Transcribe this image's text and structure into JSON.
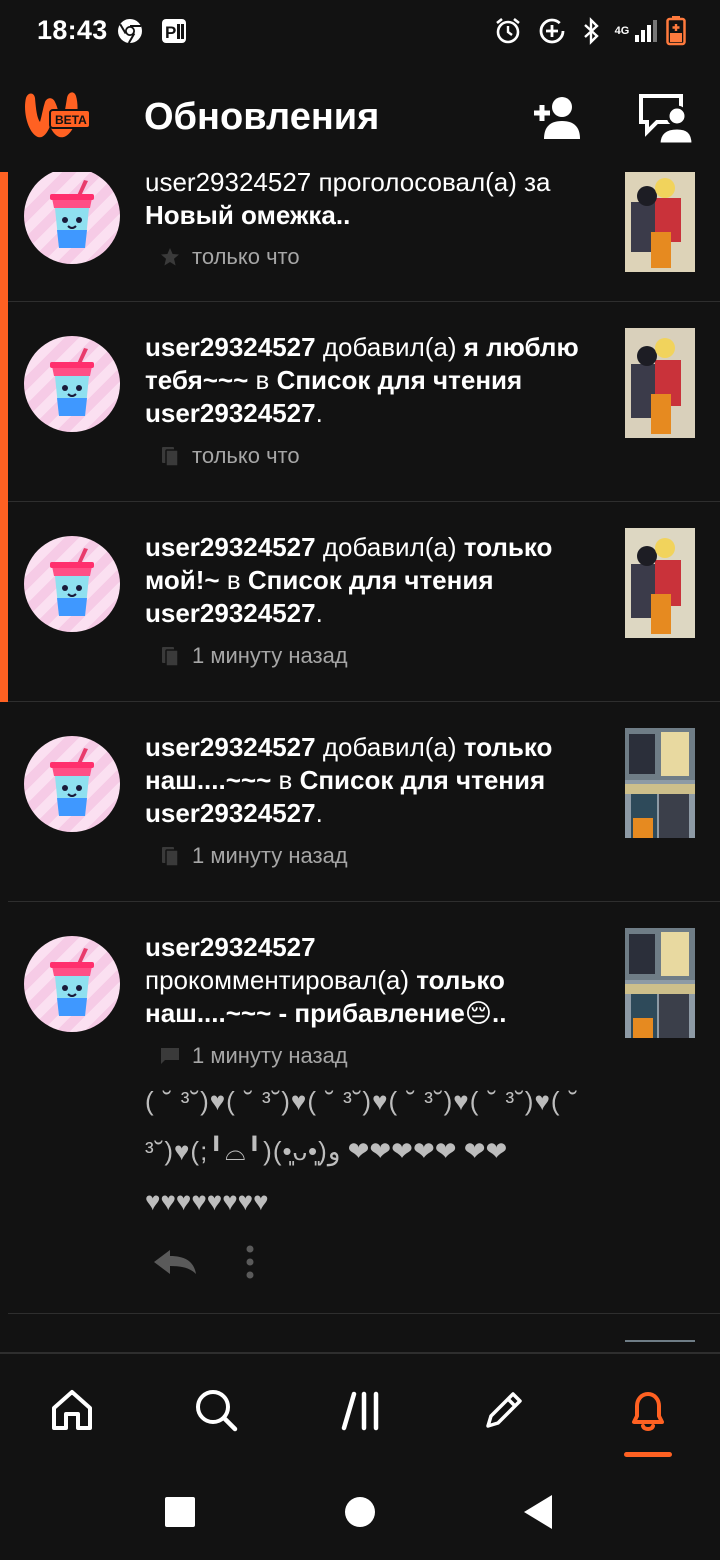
{
  "status_bar": {
    "time": "18:43",
    "network": "4G",
    "icons": [
      "chrome-icon",
      "parking-app-icon",
      "alarm-icon",
      "data-saver-icon",
      "bluetooth-icon",
      "signal-icon",
      "battery-icon"
    ]
  },
  "app_bar": {
    "logo_badge": "BETA",
    "title": "Обновления",
    "actions": [
      "add-friend-icon",
      "messages-icon"
    ]
  },
  "colors": {
    "accent": "#ff6122",
    "background": "#121212",
    "divider": "#2e2e2e",
    "meta_text": "#a6a6a6"
  },
  "feed": [
    {
      "unread": true,
      "user": "user29324527",
      "action": "проголосовал(а) за",
      "title": "Новый омежка..",
      "suffix": "",
      "meta_icon": "star-icon",
      "time": "только что"
    },
    {
      "unread": true,
      "user": "user29324527",
      "action": "добавил(а)",
      "title": "я люблю тебя~~~",
      "in": "в",
      "list": "Список для чтения user29324527",
      "end": ".",
      "meta_icon": "library-icon",
      "time": "только что"
    },
    {
      "unread": true,
      "user": "user29324527",
      "action": "добавил(а)",
      "title": "только мой!~",
      "in": "в",
      "list": "Список для чтения user29324527",
      "end": ".",
      "meta_icon": "library-icon",
      "time": "1 минуту назад"
    },
    {
      "unread": false,
      "user": "user29324527",
      "action": "добавил(а)",
      "title": "только наш....~~~",
      "in": "в",
      "list": "Список для чтения user29324527",
      "end": ".",
      "meta_icon": "library-icon",
      "time": "1 минуту назад"
    },
    {
      "unread": false,
      "user": "user29324527",
      "action": "прокомментировал(а)",
      "title": "только наш....~~~ - прибавление😔..",
      "meta_icon": "comment-icon",
      "time": "1 минуту назад",
      "comment": "( ˘ ³˘)♥( ˘ ³˘)♥( ˘ ³˘)♥( ˘ ³˘)♥( ˘ ³˘)♥( ˘ ³˘)♥(;╹⌓╹)(•͈ᴗ•͈)و ❤❤❤❤❤ ❤❤♥♥♥♥♥♥♥♥",
      "actions": [
        "reply-icon",
        "more-options-icon"
      ]
    }
  ],
  "bottom_nav": {
    "items": [
      "home-icon",
      "search-icon",
      "library-icon",
      "write-icon",
      "notifications-icon"
    ],
    "active": "notifications-icon"
  },
  "system_nav": [
    "recents-button",
    "home-button",
    "back-button"
  ]
}
